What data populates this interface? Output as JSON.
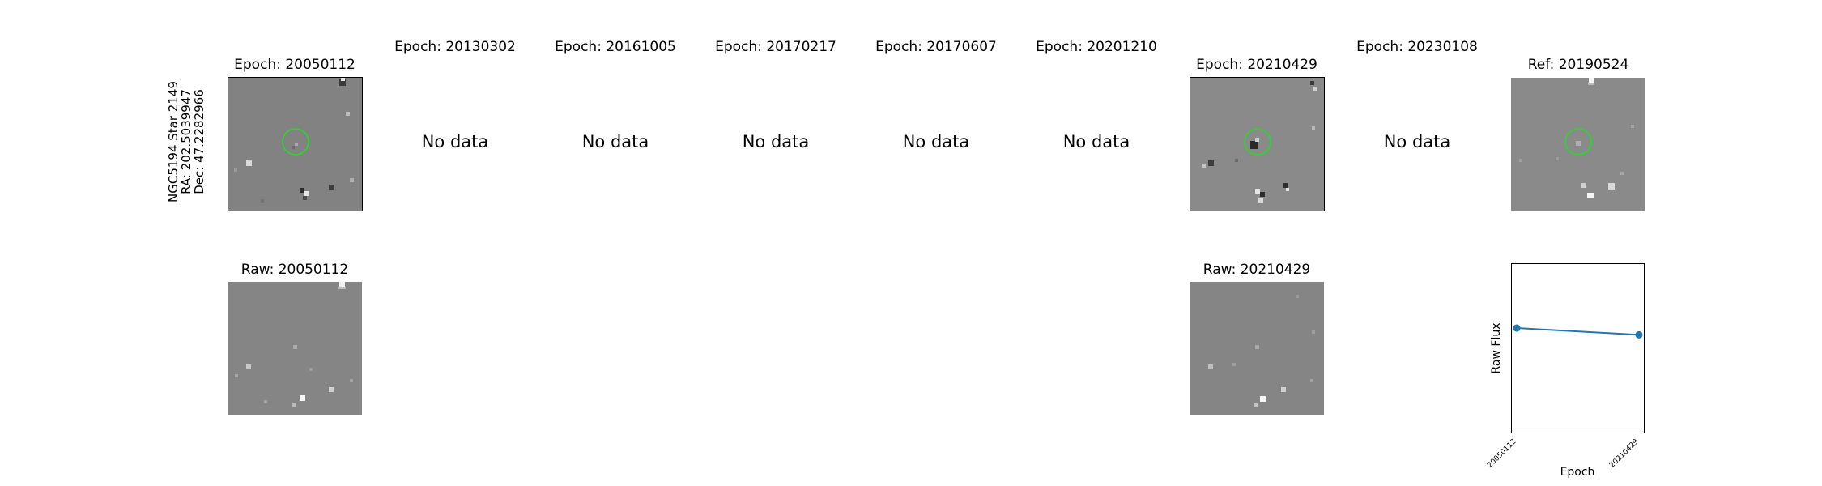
{
  "star_label": {
    "name": "NGC5194 Star 2149",
    "ra": "RA: 202.5039947",
    "dec": "Dec: 47.2282966"
  },
  "epoch_titles": [
    "Epoch: 20050112",
    "Epoch: 20130302",
    "Epoch: 20161005",
    "Epoch: 20170217",
    "Epoch: 20170607",
    "Epoch: 20201210",
    "Epoch: 20210429",
    "Epoch: 20230108",
    "Ref: 20190524"
  ],
  "no_data_text": "No data",
  "raw_titles": [
    "Raw: 20050112",
    "Raw: 20210429"
  ],
  "colors": {
    "circle": "#22dd22",
    "line": "#1f77b4",
    "background": "#808080"
  },
  "chart_data": {
    "type": "line",
    "x": [
      "20050112",
      "20210429"
    ],
    "series": [
      {
        "values": [
          0.62,
          0.58
        ]
      }
    ],
    "ylim": [
      0,
      1
    ],
    "xlabel": "Epoch",
    "ylabel": "Raw Flux",
    "grid": false
  }
}
